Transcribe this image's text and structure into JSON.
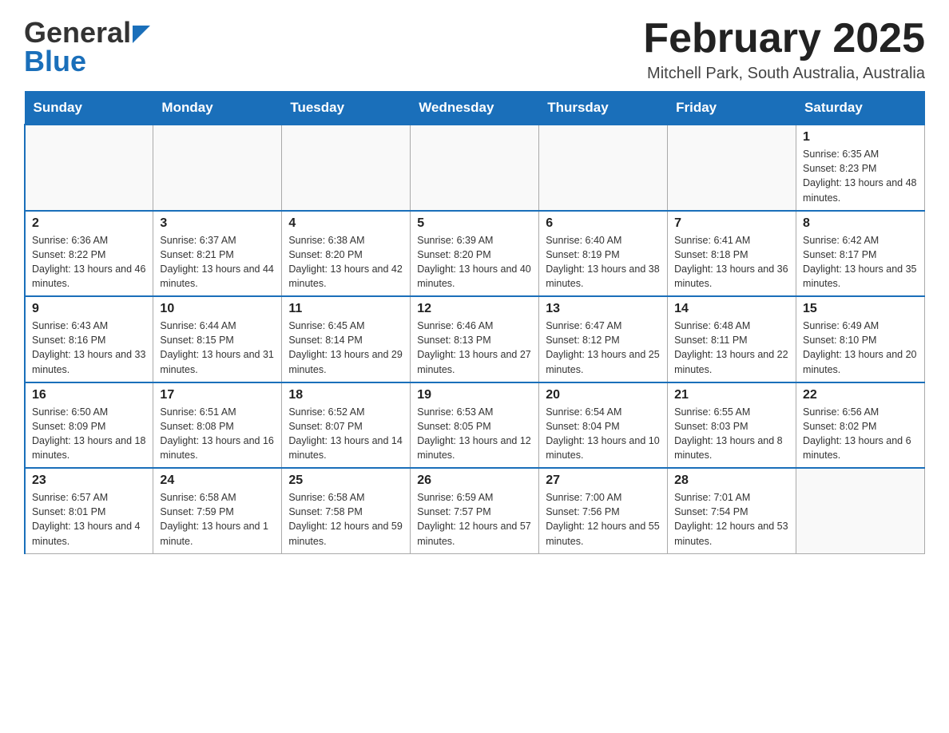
{
  "header": {
    "logo_general": "General",
    "logo_blue": "Blue",
    "title": "February 2025",
    "location": "Mitchell Park, South Australia, Australia"
  },
  "days_of_week": [
    "Sunday",
    "Monday",
    "Tuesday",
    "Wednesday",
    "Thursday",
    "Friday",
    "Saturday"
  ],
  "weeks": [
    [
      {
        "day": "",
        "info": ""
      },
      {
        "day": "",
        "info": ""
      },
      {
        "day": "",
        "info": ""
      },
      {
        "day": "",
        "info": ""
      },
      {
        "day": "",
        "info": ""
      },
      {
        "day": "",
        "info": ""
      },
      {
        "day": "1",
        "info": "Sunrise: 6:35 AM\nSunset: 8:23 PM\nDaylight: 13 hours and 48 minutes."
      }
    ],
    [
      {
        "day": "2",
        "info": "Sunrise: 6:36 AM\nSunset: 8:22 PM\nDaylight: 13 hours and 46 minutes."
      },
      {
        "day": "3",
        "info": "Sunrise: 6:37 AM\nSunset: 8:21 PM\nDaylight: 13 hours and 44 minutes."
      },
      {
        "day": "4",
        "info": "Sunrise: 6:38 AM\nSunset: 8:20 PM\nDaylight: 13 hours and 42 minutes."
      },
      {
        "day": "5",
        "info": "Sunrise: 6:39 AM\nSunset: 8:20 PM\nDaylight: 13 hours and 40 minutes."
      },
      {
        "day": "6",
        "info": "Sunrise: 6:40 AM\nSunset: 8:19 PM\nDaylight: 13 hours and 38 minutes."
      },
      {
        "day": "7",
        "info": "Sunrise: 6:41 AM\nSunset: 8:18 PM\nDaylight: 13 hours and 36 minutes."
      },
      {
        "day": "8",
        "info": "Sunrise: 6:42 AM\nSunset: 8:17 PM\nDaylight: 13 hours and 35 minutes."
      }
    ],
    [
      {
        "day": "9",
        "info": "Sunrise: 6:43 AM\nSunset: 8:16 PM\nDaylight: 13 hours and 33 minutes."
      },
      {
        "day": "10",
        "info": "Sunrise: 6:44 AM\nSunset: 8:15 PM\nDaylight: 13 hours and 31 minutes."
      },
      {
        "day": "11",
        "info": "Sunrise: 6:45 AM\nSunset: 8:14 PM\nDaylight: 13 hours and 29 minutes."
      },
      {
        "day": "12",
        "info": "Sunrise: 6:46 AM\nSunset: 8:13 PM\nDaylight: 13 hours and 27 minutes."
      },
      {
        "day": "13",
        "info": "Sunrise: 6:47 AM\nSunset: 8:12 PM\nDaylight: 13 hours and 25 minutes."
      },
      {
        "day": "14",
        "info": "Sunrise: 6:48 AM\nSunset: 8:11 PM\nDaylight: 13 hours and 22 minutes."
      },
      {
        "day": "15",
        "info": "Sunrise: 6:49 AM\nSunset: 8:10 PM\nDaylight: 13 hours and 20 minutes."
      }
    ],
    [
      {
        "day": "16",
        "info": "Sunrise: 6:50 AM\nSunset: 8:09 PM\nDaylight: 13 hours and 18 minutes."
      },
      {
        "day": "17",
        "info": "Sunrise: 6:51 AM\nSunset: 8:08 PM\nDaylight: 13 hours and 16 minutes."
      },
      {
        "day": "18",
        "info": "Sunrise: 6:52 AM\nSunset: 8:07 PM\nDaylight: 13 hours and 14 minutes."
      },
      {
        "day": "19",
        "info": "Sunrise: 6:53 AM\nSunset: 8:05 PM\nDaylight: 13 hours and 12 minutes."
      },
      {
        "day": "20",
        "info": "Sunrise: 6:54 AM\nSunset: 8:04 PM\nDaylight: 13 hours and 10 minutes."
      },
      {
        "day": "21",
        "info": "Sunrise: 6:55 AM\nSunset: 8:03 PM\nDaylight: 13 hours and 8 minutes."
      },
      {
        "day": "22",
        "info": "Sunrise: 6:56 AM\nSunset: 8:02 PM\nDaylight: 13 hours and 6 minutes."
      }
    ],
    [
      {
        "day": "23",
        "info": "Sunrise: 6:57 AM\nSunset: 8:01 PM\nDaylight: 13 hours and 4 minutes."
      },
      {
        "day": "24",
        "info": "Sunrise: 6:58 AM\nSunset: 7:59 PM\nDaylight: 13 hours and 1 minute."
      },
      {
        "day": "25",
        "info": "Sunrise: 6:58 AM\nSunset: 7:58 PM\nDaylight: 12 hours and 59 minutes."
      },
      {
        "day": "26",
        "info": "Sunrise: 6:59 AM\nSunset: 7:57 PM\nDaylight: 12 hours and 57 minutes."
      },
      {
        "day": "27",
        "info": "Sunrise: 7:00 AM\nSunset: 7:56 PM\nDaylight: 12 hours and 55 minutes."
      },
      {
        "day": "28",
        "info": "Sunrise: 7:01 AM\nSunset: 7:54 PM\nDaylight: 12 hours and 53 minutes."
      },
      {
        "day": "",
        "info": ""
      }
    ]
  ]
}
